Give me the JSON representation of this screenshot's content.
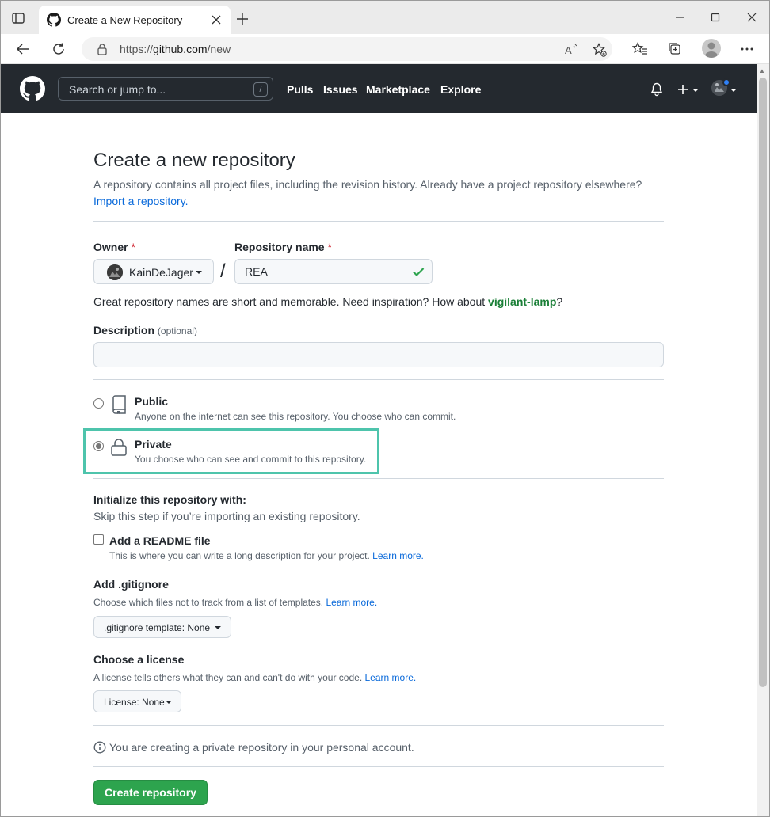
{
  "browser": {
    "tab_title": "Create a New Repository",
    "url_prefix": "https://",
    "url_host": "github.com",
    "url_path": "/new"
  },
  "gh_header": {
    "search_placeholder": "Search or jump to...",
    "search_key": "/",
    "nav": [
      "Pulls",
      "Issues",
      "Marketplace",
      "Explore"
    ],
    "plus": "+"
  },
  "page": {
    "title": "Create a new repository",
    "subtitle": "A repository contains all project files, including the revision history. Already have a project repository elsewhere?",
    "import_link": "Import a repository."
  },
  "form": {
    "owner_label": "Owner",
    "required_mark": "*",
    "owner_value": "KainDeJager",
    "slash": "/",
    "repo_label": "Repository name",
    "repo_value": "REA",
    "hint_prefix": "Great repository names are short and memorable. Need inspiration? How about ",
    "hint_suggestion": "vigilant-lamp",
    "hint_suffix": "?",
    "description_label": "Description",
    "description_optional": "(optional)",
    "description_value": ""
  },
  "visibility": {
    "selected": "private",
    "options": [
      {
        "title": "Public",
        "desc": "Anyone on the internet can see this repository. You choose who can commit."
      },
      {
        "title": "Private",
        "desc": "You choose who can see and commit to this repository."
      }
    ]
  },
  "init": {
    "title": "Initialize this repository with:",
    "subtitle": "Skip this step if you’re importing an existing repository.",
    "readme_label": "Add a README file",
    "readme_desc": "This is where you can write a long description for your project.",
    "readme_checked": false,
    "learn_more": "Learn more.",
    "gitignore_title": "Add .gitignore",
    "gitignore_desc": "Choose which files not to track from a list of templates.",
    "gitignore_button": ".gitignore template: None",
    "license_title": "Choose a license",
    "license_desc": "A license tells others what they can and can't do with your code.",
    "license_button": "License: None"
  },
  "footer": {
    "info": "You are creating a private repository in your personal account.",
    "create_button": "Create repository"
  },
  "colors": {
    "gh_header_bg": "#24292f",
    "primary_green": "#2da44e",
    "link_blue": "#0969da",
    "suggestion_green": "#1a7f37",
    "highlight_teal": "#4ec4ac"
  }
}
